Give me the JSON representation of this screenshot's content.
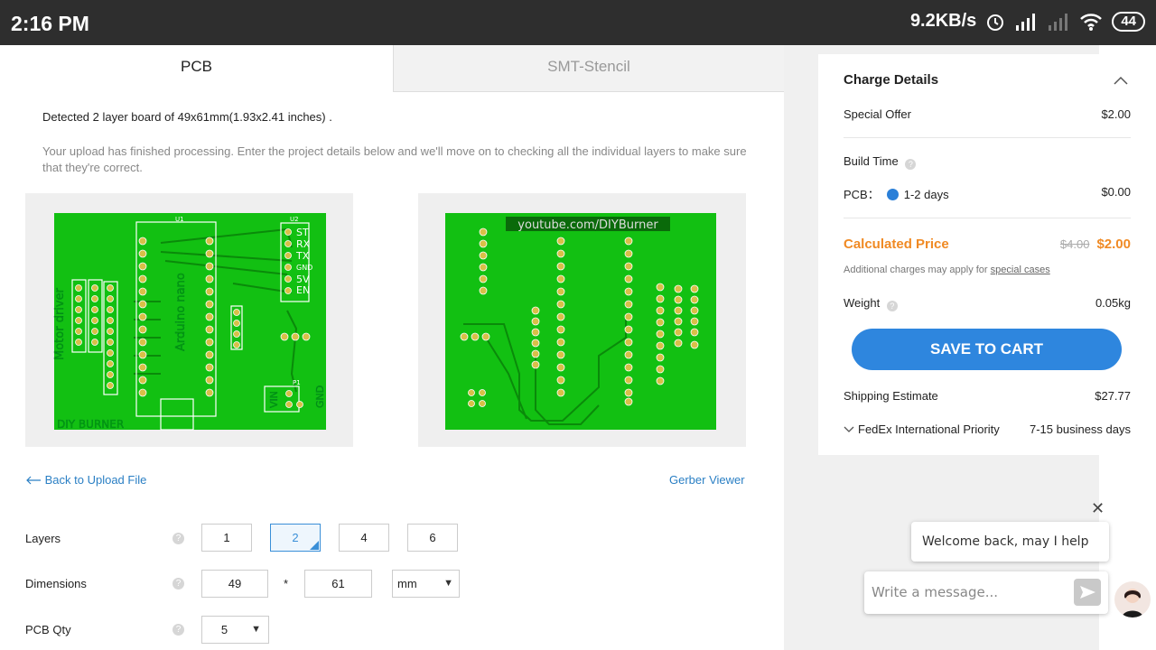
{
  "status": {
    "time": "2:16 PM",
    "speed": "9.2KB/s",
    "battery": "44"
  },
  "tabs": [
    {
      "label": "PCB"
    },
    {
      "label": "SMT-Stencil"
    }
  ],
  "detected": "Detected 2 layer board of 49x61mm(1.93x2.41 inches) .",
  "upload_message": "Your upload has finished processing. Enter the project details below and we'll move on to checking all the individual layers to make sure that they're correct.",
  "board": {
    "top_labels": {
      "motor": "Motor driver",
      "arduino": "Arduino nano",
      "footer": "DIY BURNER",
      "pins": [
        "ST",
        "RX",
        "TX",
        "GND",
        "5V",
        "EN"
      ],
      "vin": "VIN",
      "gnd": "GND",
      "u1": "U1",
      "u2": "U2",
      "p1": "P1"
    },
    "bottom_label": "youtube.com/DIYBurner",
    "colors": {
      "board": "#12c012",
      "pad": "#d8c048",
      "trace": "#0a8a0a",
      "silk": "#ffffff"
    }
  },
  "links": {
    "back": "Back to Upload File",
    "gerber": "Gerber Viewer"
  },
  "form": {
    "layers_label": "Layers",
    "layers_options": [
      "1",
      "2",
      "4",
      "6"
    ],
    "layers_selected": "2",
    "dimensions_label": "Dimensions",
    "dim_x": "49",
    "dim_sep": "*",
    "dim_y": "61",
    "dim_unit": "mm",
    "qty_label": "PCB Qty",
    "qty": "5"
  },
  "charge": {
    "title": "Charge Details",
    "special_offer_label": "Special Offer",
    "special_offer_value": "$2.00",
    "build_time_label": "Build Time",
    "pcb_label": "PCB：",
    "pcb_option": "1-2 days",
    "pcb_value": "$0.00",
    "calc_label": "Calculated Price",
    "calc_old": "$4.00",
    "calc_new": "$2.00",
    "additional": "Additional charges may apply for ",
    "special_cases": "special cases",
    "weight_label": "Weight",
    "weight_value": "0.05kg",
    "save_button": "SAVE TO CART",
    "shipping_label": "Shipping Estimate",
    "shipping_value": "$27.77",
    "carrier": "FedEx International Priority",
    "carrier_time": "7-15 business days"
  },
  "chat": {
    "welcome": "Welcome back, may I help you?",
    "placeholder": "Write a message..."
  }
}
